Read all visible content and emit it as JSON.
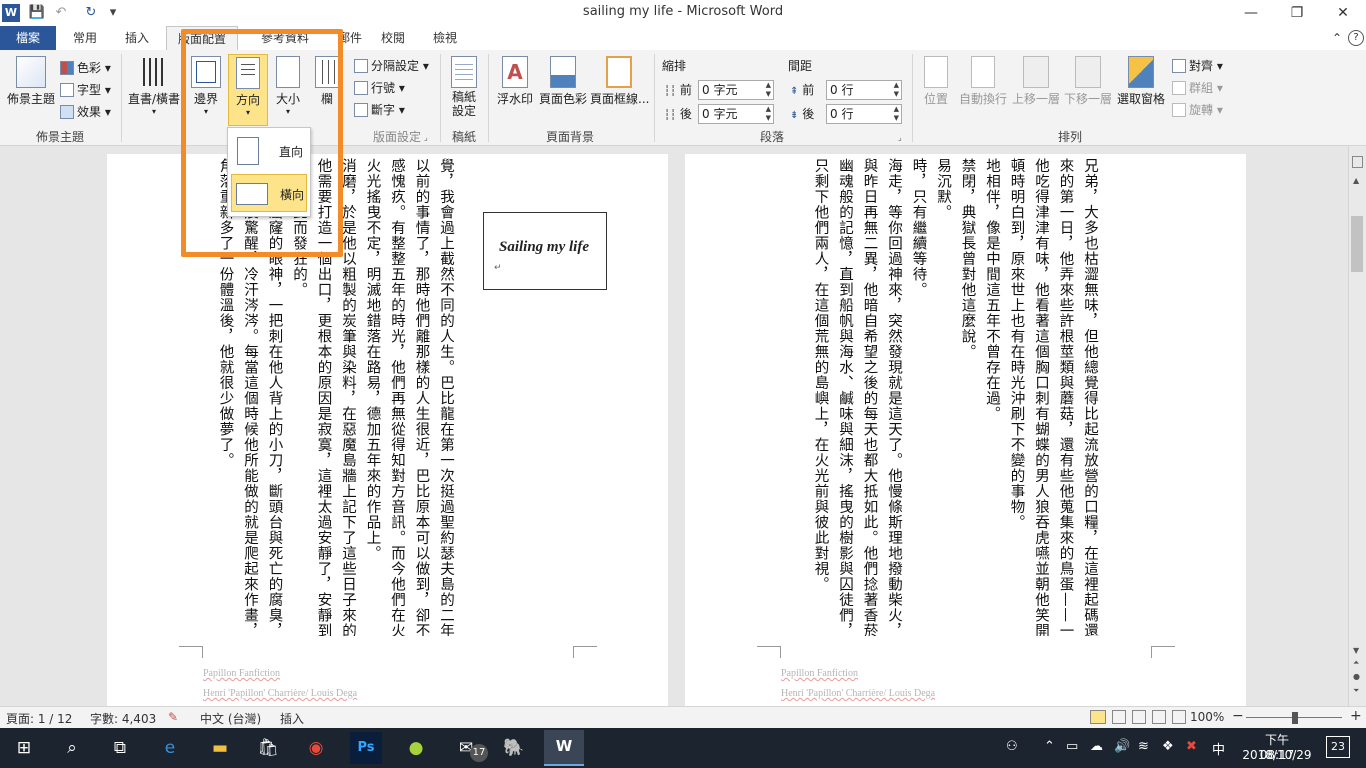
{
  "window": {
    "title": "sailing my life  -  Microsoft Word",
    "app_icon": "W",
    "minimize": "—",
    "restore": "❐",
    "close": "✕"
  },
  "quick_access": {
    "save": "💾",
    "undo": "↶",
    "redo": "↻",
    "customize": "▾"
  },
  "tabs": {
    "file": "檔案",
    "home": "常用",
    "insert": "插入",
    "layout": "版面配置",
    "references": "參考資料",
    "mailings": "郵件",
    "review": "校閱",
    "view": "檢視",
    "collapse": "⌃",
    "help": "?"
  },
  "ribbon": {
    "themes": {
      "themes": "佈景主題",
      "colors": "色彩",
      "fonts": "字型",
      "effects": "效果",
      "group": "佈景主題"
    },
    "page_setup": {
      "text_direction": "直書/橫書",
      "margins": "邊界",
      "orientation": "方向",
      "size": "大小",
      "columns": "欄",
      "breaks": "分隔設定",
      "line_numbers": "行號",
      "hyphenation": "斷字",
      "group": "版面設定"
    },
    "manuscript": {
      "label": "稿紙\n設定",
      "group": "稿紙"
    },
    "page_background": {
      "watermark": "浮水印",
      "page_color": "頁面色彩",
      "page_borders": "頁面框線...",
      "group": "頁面背景"
    },
    "paragraph": {
      "indent": "縮排",
      "spacing": "間距",
      "before": "前",
      "after": "後",
      "indent_before_value": "0 字元",
      "indent_after_value": "0 字元",
      "spacing_before_value": "0 行",
      "spacing_after_value": "0 行",
      "group": "段落"
    },
    "arrange": {
      "position": "位置",
      "wrap_text": "自動換行",
      "bring_forward": "上移一層",
      "send_backward": "下移一層",
      "selection_pane": "選取窗格",
      "align": "對齊",
      "group_objects": "群組",
      "rotate": "旋轉",
      "group": "排列"
    }
  },
  "orientation_menu": {
    "portrait": "直向",
    "landscape": "橫向"
  },
  "document": {
    "textbox": "Sailing my life",
    "left_page_columns": [
      "覺，我會過上截然不同的人生。巴比龍在第一次挺過聖約瑟夫島的二年禁閉後對他",
      "以前的事情了，那時他們離那樣的人生很近，巴比原本可以做到，卻不顧一切地",
      "感愧疚。有整整五年的時光，他們再無從得知對方音訊。而今他們在火堆前並肩",
      "火光搖曳不定，明滅地錯落在路易，德加五年來的作品上。",
      "消磨，於是他以粗製的炭筆與染料，在惡魔島牆上記下了這些日子來的經歷。有",
      "他需要打造一個出口，更根本的原因是寂寞，這裡太過安靜了，安靜到只能聽見",
      "們都因此而發狂的。",
      "漆黑如窟窿的眼神，一把刺在他人背上的小刀，斷頭台與死亡的腐臭，",
      "會在清晨驚醒，冷汗涔涔。每當這個時候他所能做的就是爬起來作畫，",
      "角落重新多了一份體溫後，他就很少做夢了。"
    ],
    "right_page_columns": [
      "兄弟，大多也枯澀無味，但他總覺得比起流放營的口糧，在這裡起碼還保有一點自己",
      "來的第一日，他弄來些許根莖類與蘑菇，還有些他蒐集來的鳥蛋——一頓實在稱",
      "他吃得津津有味，他看著這個胸口刺有蝴蝶的男人狼吞虎嚥並朝他笑開（那幾乎",
      "頓時明白到，原來世上也有在時光沖刷下不變的事物。",
      "地相伴，像是中間這五年不曾存在過。",
      "禁閉，典獄長曾對他這麼說。",
      "易沉默。",
      "時，只有繼續等待。",
      "海走，等你回過神來，突然發現就是這天了。他慢條斯理地撥動柴火，巴比在他",
      "與昨日再無二異，他暗自希望之後的每天也都大抵如此。他們捻著香菸，在這斑",
      "幽魂般的記憶，直到船帆與海水、鹹味與細沫，搖曳的樹影與囚徒們，都在這面",
      "只剩下他們兩人，在這個荒無的島嶼上，在火光前與彼此對視。"
    ],
    "footer_line1": "Papillon Fanfiction",
    "footer_line2": "Henri 'Papillon' Charrière/ Louis Dega"
  },
  "status": {
    "page": "頁面: 1 / 12",
    "words": "字數: 4,403",
    "language": "中文 (台灣)",
    "mode": "插入",
    "zoom": "100%",
    "zoom_minus": "−",
    "zoom_plus": "+"
  },
  "taskbar": {
    "mail_badge": "17",
    "ime": "中",
    "time": "下午 08:17",
    "date": "2018/10/29",
    "notifications": "23"
  },
  "colors": {
    "brand": "#2b579a",
    "highlight": "#f28c28",
    "taskbar": "#1c2430"
  }
}
